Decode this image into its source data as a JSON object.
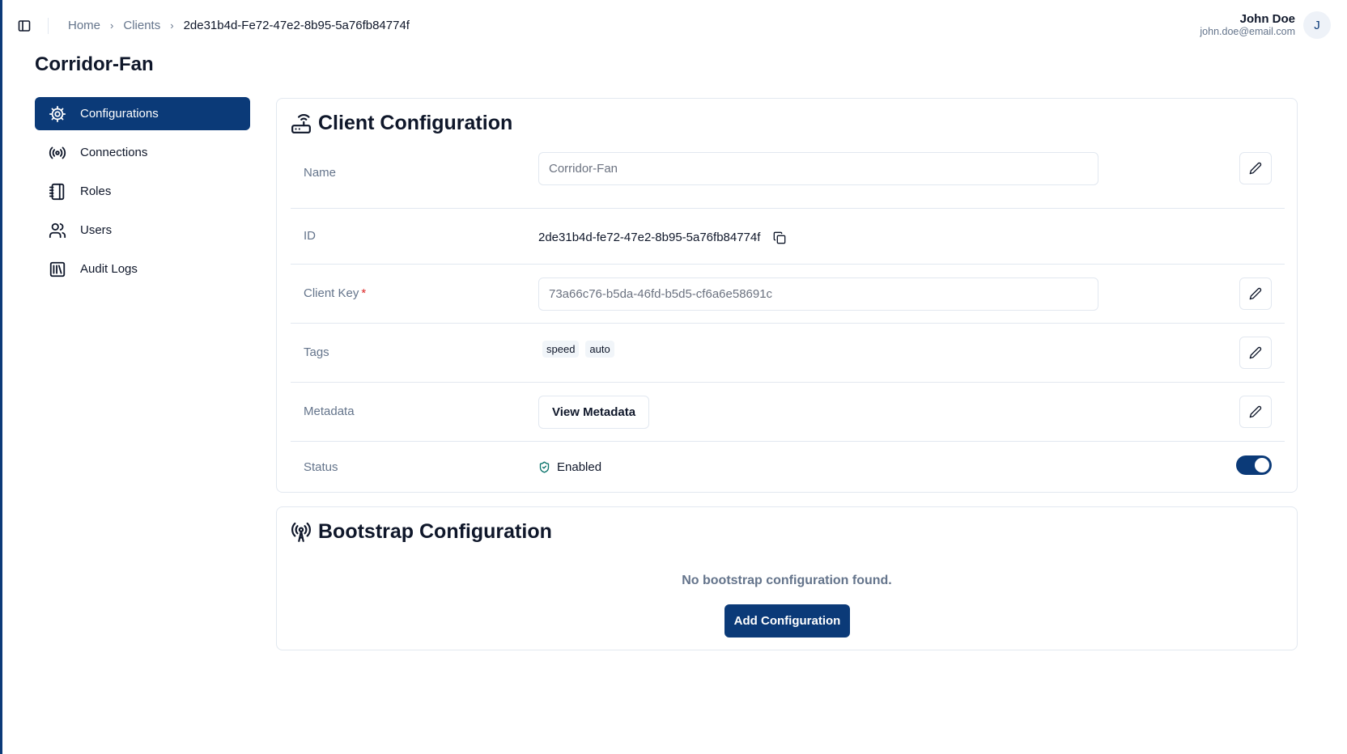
{
  "header": {
    "breadcrumb": [
      "Home",
      "Clients",
      "2de31b4d-Fe72-47e2-8b95-5a76fb84774f"
    ],
    "user": {
      "name": "John Doe",
      "email": "john.doe@email.com",
      "initial": "J"
    }
  },
  "page": {
    "title": "Corridor-Fan"
  },
  "sidebar": {
    "items": [
      {
        "label": "Configurations",
        "icon": "gear-icon",
        "active": true
      },
      {
        "label": "Connections",
        "icon": "broadcast-icon",
        "active": false
      },
      {
        "label": "Roles",
        "icon": "notebook-icon",
        "active": false
      },
      {
        "label": "Users",
        "icon": "users-icon",
        "active": false
      },
      {
        "label": "Audit Logs",
        "icon": "library-icon",
        "active": false
      }
    ]
  },
  "client_config": {
    "title": "Client Configuration",
    "name": {
      "label": "Name",
      "value": "Corridor-Fan"
    },
    "id": {
      "label": "ID",
      "value": "2de31b4d-fe72-47e2-8b95-5a76fb84774f"
    },
    "client_key": {
      "label": "Client Key",
      "required_mark": "*",
      "value": "73a66c76-b5da-46fd-b5d5-cf6a6e58691c"
    },
    "tags": {
      "label": "Tags",
      "items": [
        "speed",
        "auto"
      ]
    },
    "metadata": {
      "label": "Metadata",
      "button": "View Metadata"
    },
    "status": {
      "label": "Status",
      "value": "Enabled",
      "enabled": true
    }
  },
  "bootstrap_config": {
    "title": "Bootstrap Configuration",
    "empty_message": "No bootstrap configuration found.",
    "add_button": "Add Configuration"
  },
  "colors": {
    "brand": "#0b3a78",
    "success": "#0f766e",
    "required": "#dc2626"
  }
}
